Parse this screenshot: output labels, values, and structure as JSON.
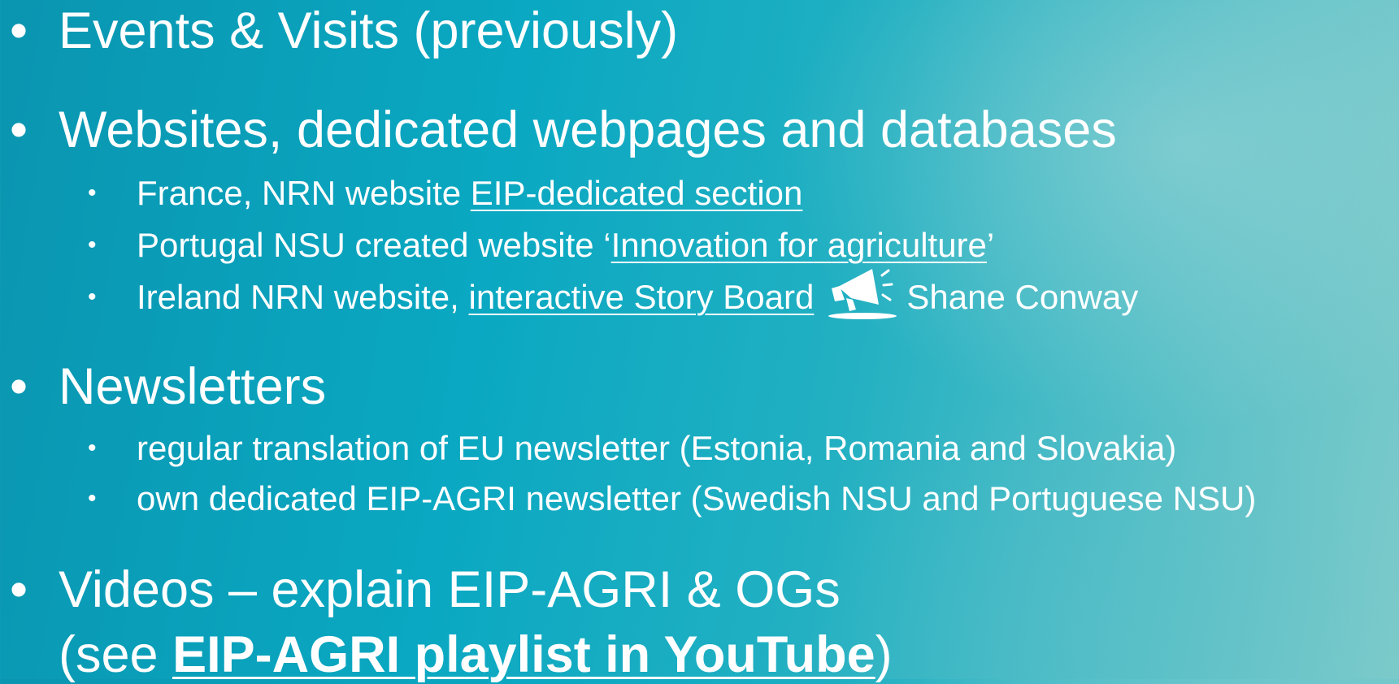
{
  "items": [
    {
      "text": "Events & Visits (previously)"
    },
    {
      "text": "Websites, dedicated webpages and databases"
    },
    {
      "prefix": "France, NRN website ",
      "link": "EIP-dedicated section"
    },
    {
      "prefix": "Portugal NSU created website ‘",
      "link": "Innovation for agriculture",
      "suffix": "’"
    },
    {
      "prefix": "Ireland NRN website, ",
      "link": "interactive Story Board",
      "icon": "megaphone-icon",
      "after_icon": "Shane Conway"
    },
    {
      "text": "Newsletters"
    },
    {
      "text": "regular translation of EU newsletter (Estonia, Romania and Slovakia)"
    },
    {
      "text": "own dedicated EIP-AGRI newsletter (Swedish NSU and Portuguese NSU)"
    },
    {
      "text": "Videos – explain EIP-AGRI & OGs"
    },
    {
      "prefix": "(see ",
      "link": "EIP-AGRI playlist in YouTube",
      "suffix": ")"
    }
  ],
  "bullet_glyph": "•"
}
